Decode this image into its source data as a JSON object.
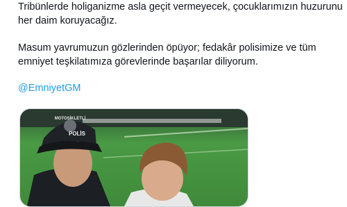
{
  "tweet": {
    "paragraph1_line1": "Tribünlerde holiganizme asla geçit vermeyecek, çocuklarımızın huzurunu",
    "paragraph1_line2": "her daim koruyacağız.",
    "paragraph2_line1": "Masum yavrumuzun gözlerinden öpüyor; fedakâr polisimize ve tüm",
    "paragraph2_line2": "emniyet teşkilatımıza görevlerinde başarılar diliyorum.",
    "mention": "@EmniyetGM"
  },
  "media": {
    "cap_text_top": "MOTOSİKLETLİ",
    "cap_text_bottom": "POLİS",
    "colors": {
      "pitch": "#3f8a3a",
      "stands": "#2a3a30",
      "cap": "#1f2226",
      "uniform": "#1c1f24",
      "skin": "#c99a7a",
      "child_hair": "#8a5a35"
    }
  }
}
